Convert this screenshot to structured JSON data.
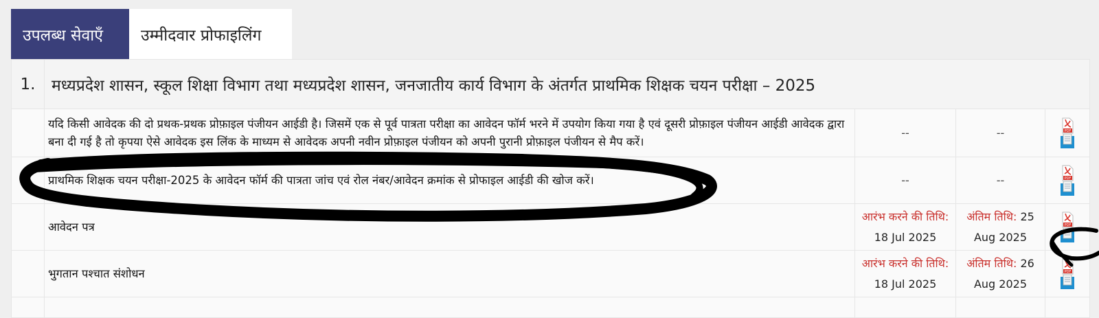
{
  "tabs": [
    {
      "label": "उपलब्ध सेवाएँ"
    },
    {
      "label": "उम्मीदवार प्रोफाइलिंग"
    }
  ],
  "section": {
    "number": "1.",
    "title": "मध्यप्रदेश शासन, स्कूल शिक्षा विभाग तथा मध्यप्रदेश शासन, जनजातीय कार्य विभाग के अंतर्गत प्राथमिक शिक्षक चयन परीक्षा – 2025"
  },
  "rows": [
    {
      "text": "यदि किसी आवेदक की दो प्रथक-प्रथक प्रोफ़ाइल पंजीयन आईडी है। जिसमें एक से पूर्व पात्रता परीक्षा का आवेदन फॉर्म भरने में उपयोग किया गया है एवं दूसरी प्रोफ़ाइल पंजीयन आईडी आवेदक द्वारा बना दी गई है तो कृपया ऐसे आवेदक इस लिंक के माध्यम से आवेदक अपनी नवीन प्रोफ़ाइल पंजीयन को अपनी पुरानी प्रोफ़ाइल पंजीयन से मैप करें।",
      "start": "--",
      "end": "--"
    },
    {
      "text": "प्राथमिक शिक्षक चयन परीक्षा-2025 के आवेदन फॉर्म की पात्रता जांच एवं रोल नंबर/आवेदन क्रमांक से प्रोफाइल आईडी की खोज करें।",
      "start": "--",
      "end": "--"
    },
    {
      "text": "आवेदन पत्र",
      "start_label": "आरंभ करने की तिथि:",
      "start_value": "18 Jul 2025",
      "end_label": "अंतिम तिथि:",
      "end_value": "25 Aug 2025"
    },
    {
      "text": "भुगतान पश्चात संशोधन",
      "start_label": "आरंभ करने की तिथि:",
      "start_value": "18 Jul 2025",
      "end_label": "अंतिम तिथि:",
      "end_value": "26 Aug 2025"
    }
  ],
  "icons": {
    "pdf": "pdf-icon",
    "doc": "document-icon"
  },
  "pdf_icon_text": "PDF",
  "colors": {
    "tab_active": "#3a3f7a",
    "date_label": "#c9302c",
    "pdf_red": "#d9342b",
    "doc_blue": "#1e8fd0"
  }
}
